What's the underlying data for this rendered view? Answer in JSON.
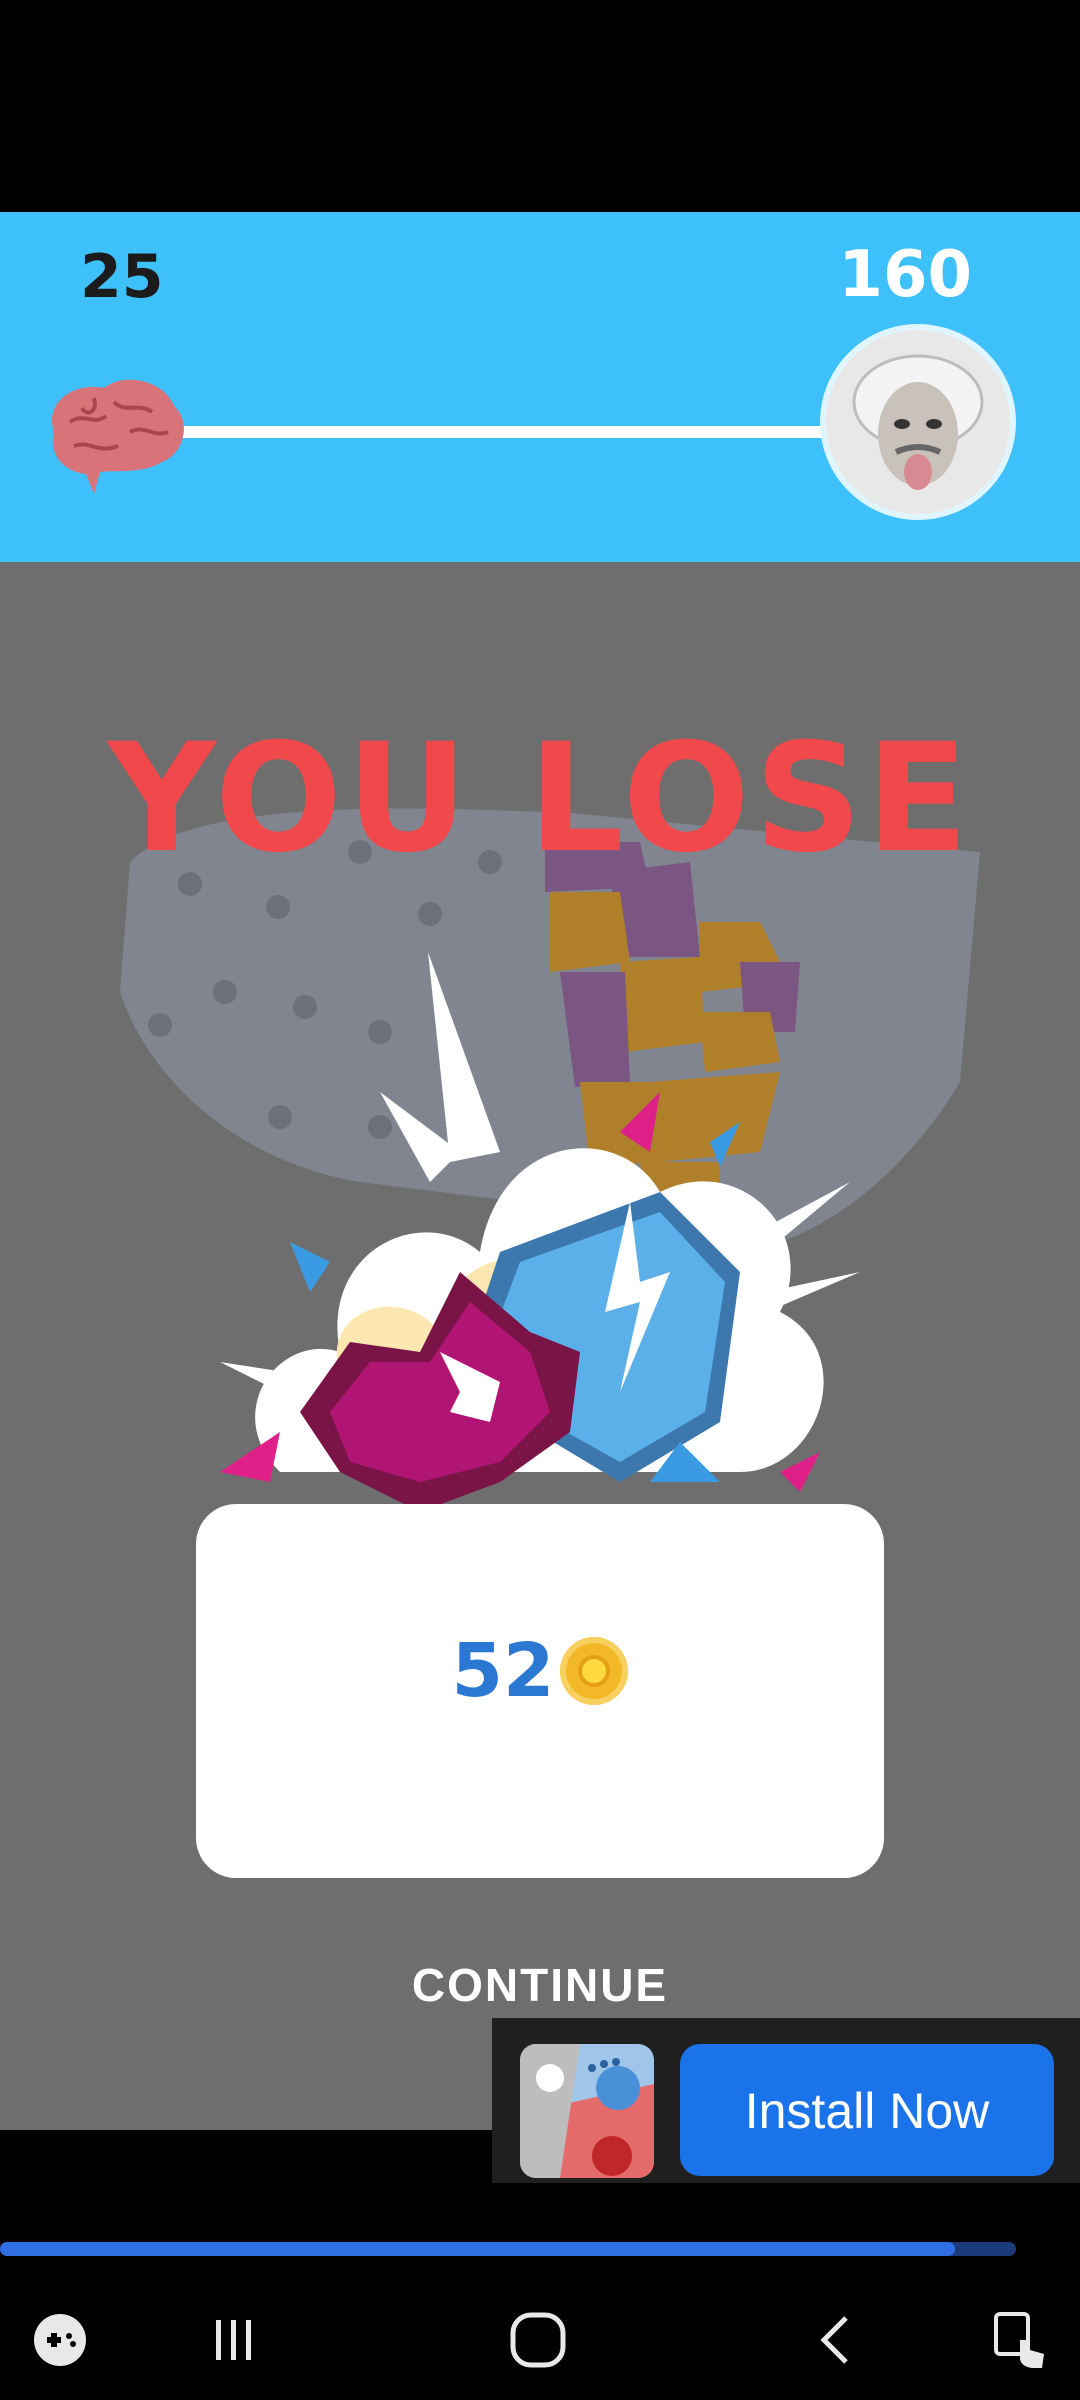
{
  "header": {
    "current_score": "25",
    "target_score": "160"
  },
  "result": {
    "title": "YOU LOSE",
    "reward_amount": "52",
    "continue_label": "CONTINUE"
  },
  "ad": {
    "install_label": "Install Now",
    "progress_fraction": 0.94
  },
  "icons": {
    "brain": "brain-icon",
    "avatar": "einstein-avatar",
    "coin": "coin-icon",
    "game_launcher": "game-launcher-icon",
    "recents": "recents-icon",
    "home": "home-icon",
    "back": "back-icon",
    "accessibility": "accessibility-icon"
  },
  "colors": {
    "header_bg": "#3ec1fb",
    "lose_text": "#f1484c",
    "install_button": "#1a73e8",
    "reward_text": "#2a78d2"
  }
}
